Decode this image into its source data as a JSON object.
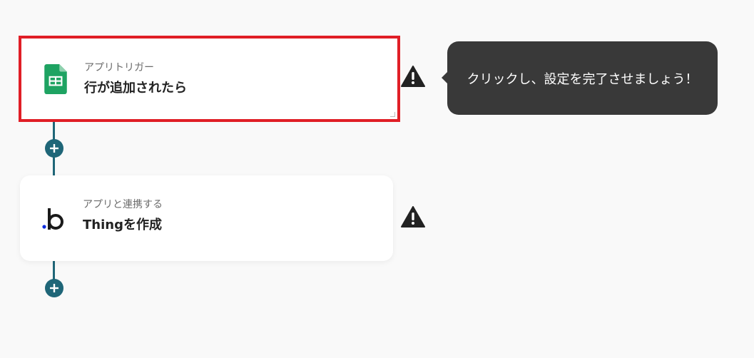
{
  "flow": {
    "steps": [
      {
        "subtitle": "アプリトリガー",
        "title": "行が追加されたら",
        "icon": "google-sheets-icon",
        "selected": true,
        "warning": true
      },
      {
        "subtitle": "アプリと連携する",
        "title": "Thingを作成",
        "icon": "bubble-icon",
        "selected": false,
        "warning": true
      }
    ],
    "add_step_icon": "plus-icon",
    "tooltip": "クリックし、設定を完了させましょう！"
  },
  "colors": {
    "background": "#f9f9f9",
    "connector": "#1f6678",
    "selection": "#e01e26",
    "tooltip_bg": "#393939",
    "sheets_green": "#1ea362",
    "warning": "#222222"
  }
}
